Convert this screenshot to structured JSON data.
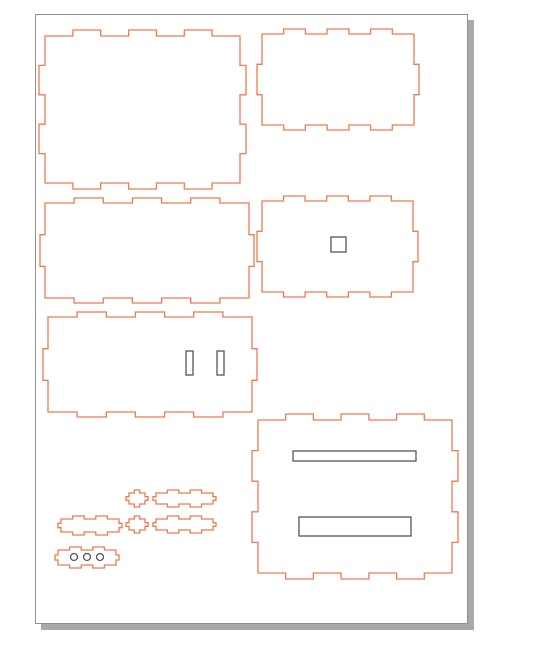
{
  "document": {
    "kind": "laser-cut box layout",
    "sheet_color": "#ffffff",
    "sheet_shadow_color": "#a9a9a9",
    "sheet_border_color": "#8f8f8f"
  },
  "colors": {
    "cut_outline": "#f07a52",
    "inner_cutout": "#555555"
  },
  "parts": [
    {
      "id": "panel-top-left",
      "tabs": "finger-joint",
      "cutouts": []
    },
    {
      "id": "panel-top-right",
      "tabs": "finger-joint",
      "cutouts": []
    },
    {
      "id": "panel-middle-left",
      "tabs": "finger-joint",
      "cutouts": []
    },
    {
      "id": "panel-middle-right",
      "tabs": "finger-joint",
      "cutouts": [
        "square-hole"
      ]
    },
    {
      "id": "panel-lower-left",
      "tabs": "finger-joint",
      "cutouts": [
        "slot-left",
        "slot-right"
      ]
    },
    {
      "id": "panel-lower-right",
      "tabs": "finger-joint",
      "cutouts": [
        "long-slot-thin",
        "long-slot-wide"
      ]
    },
    {
      "id": "small-parts",
      "count": 6,
      "with_holes": 1
    }
  ]
}
